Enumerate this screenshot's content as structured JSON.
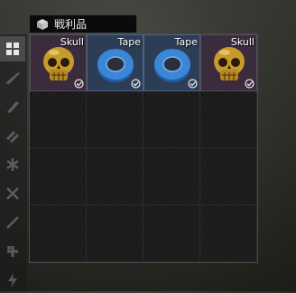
{
  "window": {
    "title": "戦利品"
  },
  "sidebar": {
    "buttons": [
      {
        "icon": "grid-icon",
        "active": true
      },
      {
        "icon": "rifle-icon",
        "active": false
      },
      {
        "icon": "knife-icon",
        "active": false
      },
      {
        "icon": "ammo-icon",
        "active": false
      },
      {
        "icon": "asterisk-icon",
        "active": false
      },
      {
        "icon": "cross-tools-icon",
        "active": false
      },
      {
        "icon": "pen-icon",
        "active": false
      },
      {
        "icon": "medical-icon",
        "active": false
      }
    ]
  },
  "loot": {
    "rows": 4,
    "cols": 4,
    "items": [
      {
        "name": "Skull",
        "icon": "skull-icon",
        "examined": true
      },
      {
        "name": "Tape",
        "icon": "tape-icon",
        "examined": true
      },
      {
        "name": "Tape",
        "icon": "tape-icon",
        "examined": true
      },
      {
        "name": "Skull",
        "icon": "skull-icon",
        "examined": true
      }
    ]
  },
  "colors": {
    "skull_bg": "#3a2c3d",
    "tape_bg": "#2c3e55",
    "grid_bg": "#1a1a1a"
  }
}
